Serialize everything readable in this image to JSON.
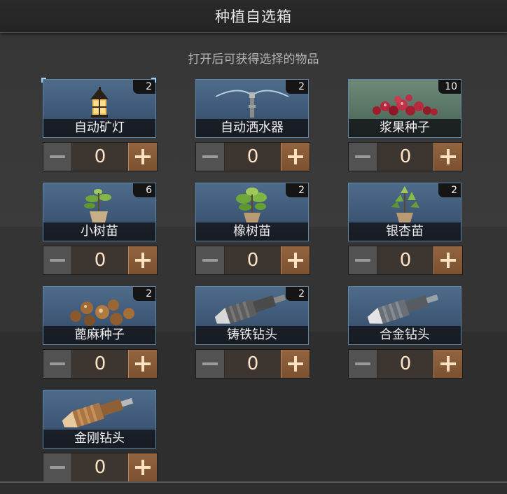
{
  "dialog": {
    "title": "种植自选箱",
    "subtitle": "打开后可获得选择的物品"
  },
  "items": [
    {
      "name": "自动矿灯",
      "count": "2",
      "quantity": "0",
      "icon": "lantern-icon"
    },
    {
      "name": "自动洒水器",
      "count": "2",
      "quantity": "0",
      "icon": "sprinkler-icon"
    },
    {
      "name": "浆果种子",
      "count": "10",
      "quantity": "0",
      "icon": "berry-seeds-icon"
    },
    {
      "name": "小树苗",
      "count": "6",
      "quantity": "0",
      "icon": "sapling-icon"
    },
    {
      "name": "橡树苗",
      "count": "2",
      "quantity": "0",
      "icon": "oak-sapling-icon"
    },
    {
      "name": "银杏苗",
      "count": "2",
      "quantity": "0",
      "icon": "ginkgo-sapling-icon"
    },
    {
      "name": "蓖麻种子",
      "count": "2",
      "quantity": "0",
      "icon": "castor-seeds-icon"
    },
    {
      "name": "铸铁钻头",
      "count": "2",
      "quantity": "0",
      "icon": "cast-iron-drill-icon"
    },
    {
      "name": "合金钻头",
      "count": "",
      "quantity": "0",
      "icon": "alloy-drill-icon"
    },
    {
      "name": "金刚钻头",
      "count": "",
      "quantity": "0",
      "icon": "diamond-drill-icon"
    }
  ]
}
